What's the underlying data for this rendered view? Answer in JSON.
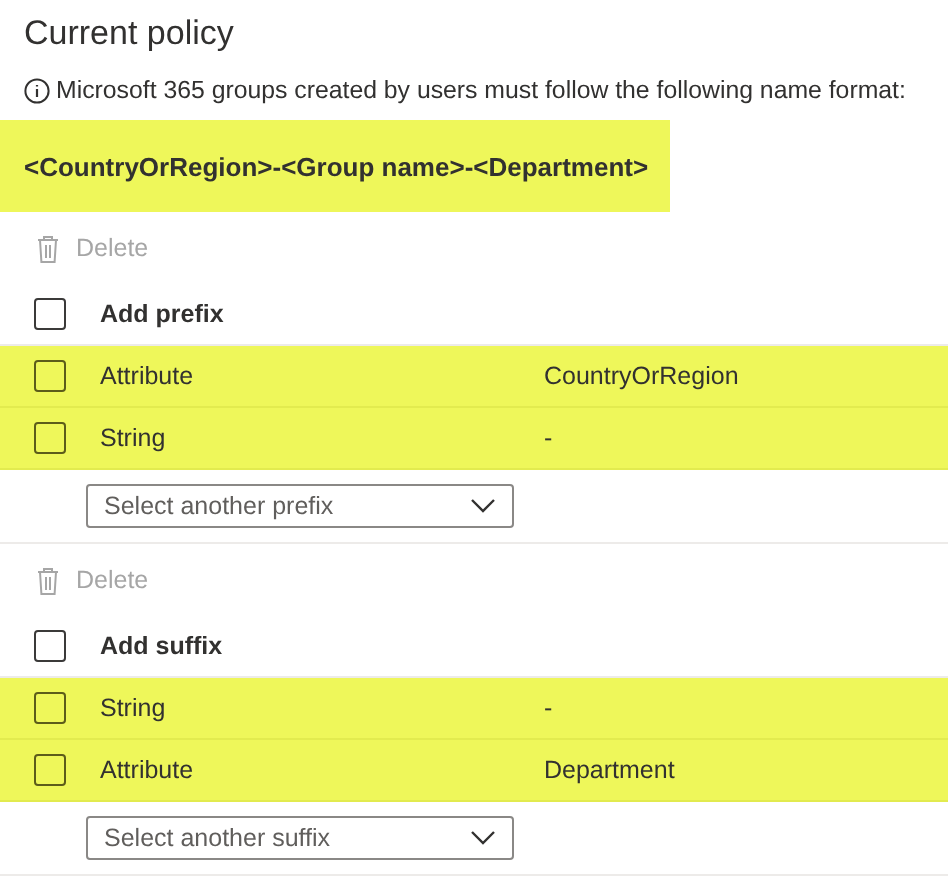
{
  "title": "Current policy",
  "info": "Microsoft 365 groups created by users must follow the following name format:",
  "format": {
    "text": "<CountryOrRegion>-<Group name>-<Department>",
    "highlighted": true
  },
  "sections": [
    {
      "delete": {
        "label": "Delete",
        "disabled": true
      },
      "header": {
        "label": "Add prefix",
        "checked": false
      },
      "rows": [
        {
          "type": "Attribute",
          "value": "CountryOrRegion",
          "checked": false,
          "highlighted": true
        },
        {
          "type": "String",
          "value": "-",
          "checked": false,
          "highlighted": true
        }
      ],
      "dropdown": {
        "placeholder": "Select another prefix"
      }
    },
    {
      "delete": {
        "label": "Delete",
        "disabled": true
      },
      "header": {
        "label": "Add suffix",
        "checked": false
      },
      "rows": [
        {
          "type": "String",
          "value": "-",
          "checked": false,
          "highlighted": true
        },
        {
          "type": "Attribute",
          "value": "Department",
          "checked": false,
          "highlighted": true
        }
      ],
      "dropdown": {
        "placeholder": "Select another suffix"
      }
    }
  ]
}
